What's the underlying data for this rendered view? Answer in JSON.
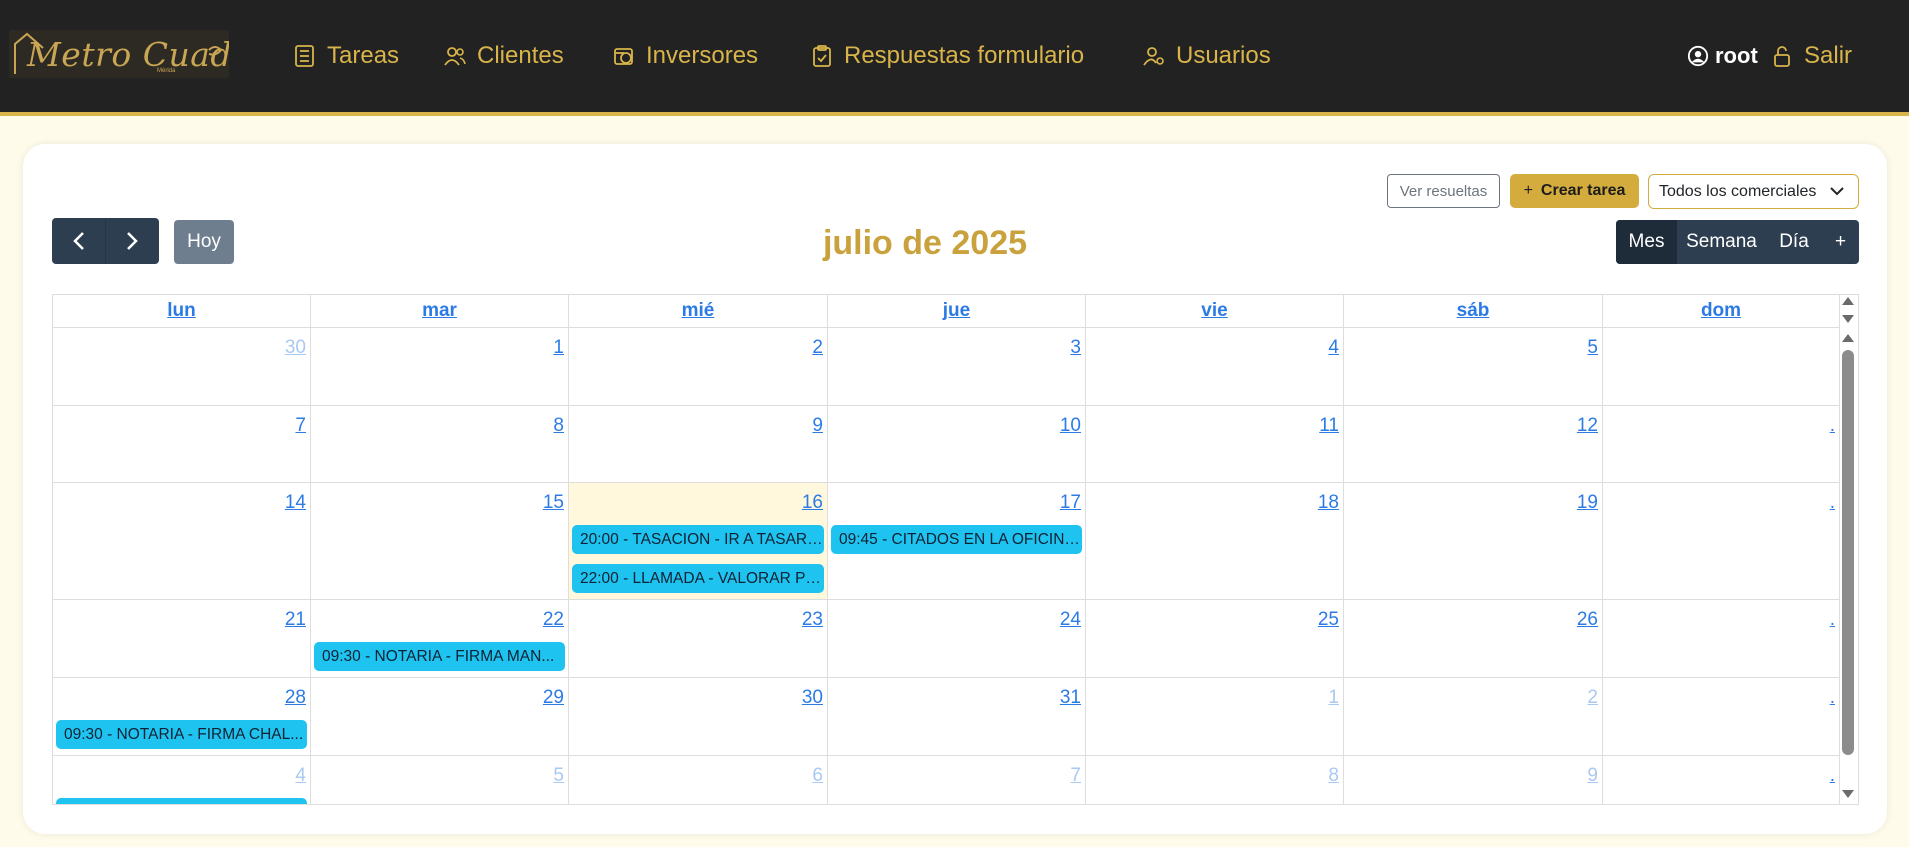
{
  "brand": {
    "logo_text": "Metro Cuadrado",
    "logo_sub": "Mérida"
  },
  "nav": {
    "items": [
      {
        "label": "Tareas",
        "icon": "list-icon"
      },
      {
        "label": "Clientes",
        "icon": "users-icon"
      },
      {
        "label": "Inversores",
        "icon": "coin-icon"
      },
      {
        "label": "Respuestas formulario",
        "icon": "clipboard-check-icon"
      },
      {
        "label": "Usuarios",
        "icon": "user-gear-icon"
      }
    ],
    "user": "root",
    "logout": "Salir"
  },
  "toolbar": {
    "ver_resueltas": "Ver resueltas",
    "crear_tarea": "Crear tarea",
    "crear_icon": "+",
    "comerciales_selected": "Todos los comerciales",
    "hoy": "Hoy",
    "title": "julio de 2025",
    "views": [
      "Mes",
      "Semana",
      "Día",
      "+"
    ],
    "active_view": "Mes"
  },
  "calendar": {
    "weekdays": [
      "lun",
      "mar",
      "mié",
      "jue",
      "vie",
      "sáb",
      "dom"
    ],
    "today_column": 2,
    "today_row": 2,
    "weeks": [
      [
        {
          "d": "30",
          "other": true
        },
        {
          "d": "1"
        },
        {
          "d": "2"
        },
        {
          "d": "3"
        },
        {
          "d": "4"
        },
        {
          "d": "5"
        },
        {
          "d": ""
        }
      ],
      [
        {
          "d": "7"
        },
        {
          "d": "8"
        },
        {
          "d": "9"
        },
        {
          "d": "10"
        },
        {
          "d": "11"
        },
        {
          "d": "12"
        },
        {
          "d": "."
        }
      ],
      [
        {
          "d": "14"
        },
        {
          "d": "15"
        },
        {
          "d": "16"
        },
        {
          "d": "17"
        },
        {
          "d": "18"
        },
        {
          "d": "19"
        },
        {
          "d": "."
        }
      ],
      [
        {
          "d": "21"
        },
        {
          "d": "22"
        },
        {
          "d": "23"
        },
        {
          "d": "24"
        },
        {
          "d": "25"
        },
        {
          "d": "26"
        },
        {
          "d": "."
        }
      ],
      [
        {
          "d": "28"
        },
        {
          "d": "29"
        },
        {
          "d": "30"
        },
        {
          "d": "31"
        },
        {
          "d": "1",
          "other": true
        },
        {
          "d": "2",
          "other": true
        },
        {
          "d": "."
        }
      ],
      [
        {
          "d": "4",
          "other": true
        },
        {
          "d": "5",
          "other": true
        },
        {
          "d": "6",
          "other": true
        },
        {
          "d": "7",
          "other": true
        },
        {
          "d": "8",
          "other": true
        },
        {
          "d": "9",
          "other": true
        },
        {
          "d": "."
        }
      ]
    ],
    "events": [
      {
        "week": 2,
        "col": 2,
        "slot": 0,
        "label": "20:00 - TASACION - IR A TASAR ..."
      },
      {
        "week": 2,
        "col": 2,
        "slot": 1,
        "label": "22:00 - LLAMADA - VALORAR PR..."
      },
      {
        "week": 2,
        "col": 3,
        "slot": 0,
        "label": "09:45 - CITADOS EN LA OFICINA..."
      },
      {
        "week": 3,
        "col": 1,
        "slot": 0,
        "label": "09:30 - NOTARIA - FIRMA MAN..."
      },
      {
        "week": 4,
        "col": 0,
        "slot": 0,
        "label": "09:30 - NOTARIA - FIRMA CHAL..."
      },
      {
        "week": 5,
        "col": 0,
        "slot": 0,
        "label": ""
      }
    ]
  },
  "colors": {
    "accent": "#d4ac3e",
    "navbar": "#222222",
    "event": "#1fc3f0",
    "today": "#fff8dd",
    "link": "#2c7be5"
  }
}
